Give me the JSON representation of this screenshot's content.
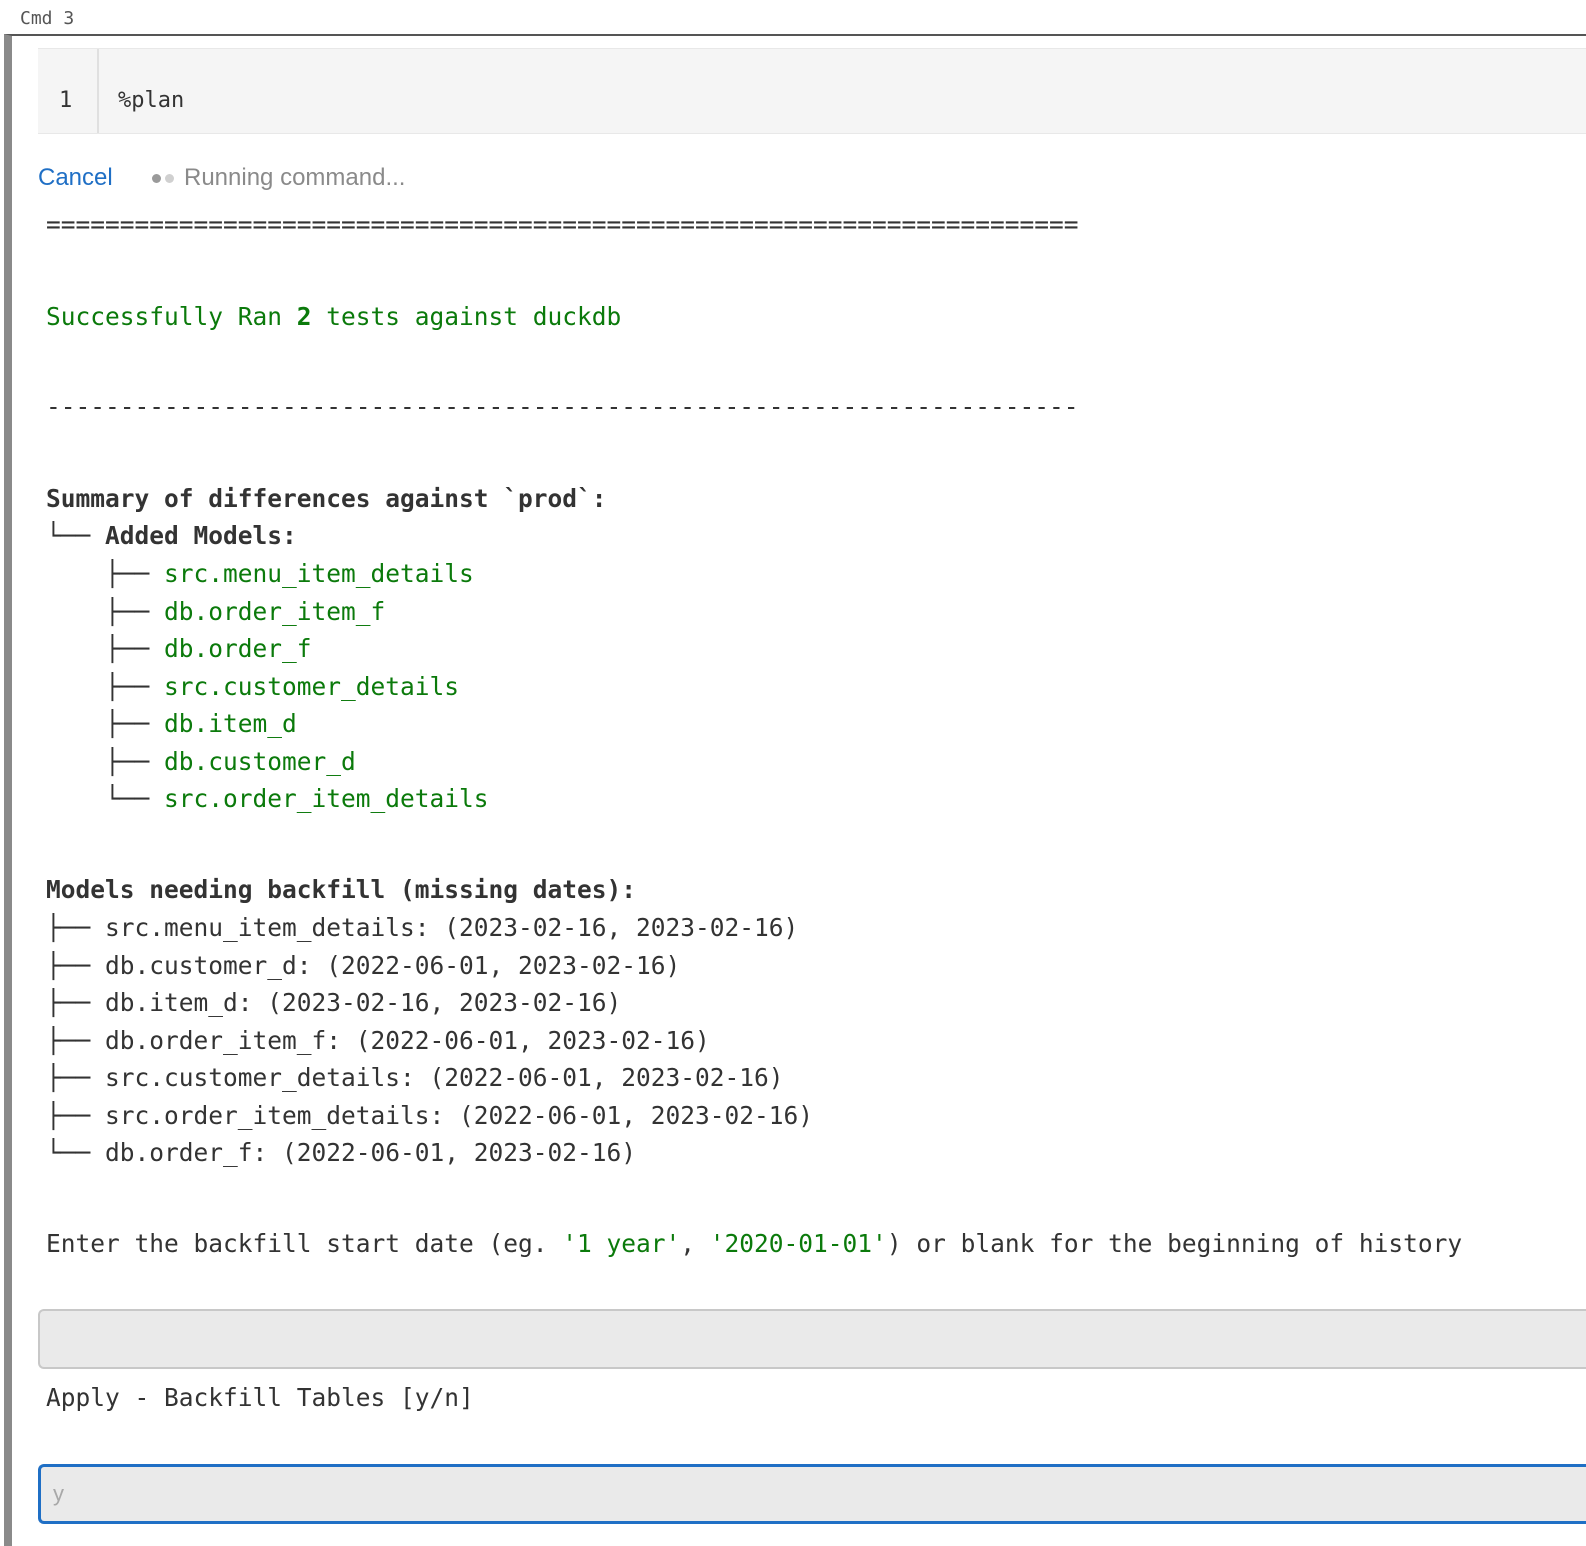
{
  "cell": {
    "label": "Cmd 3"
  },
  "editor": {
    "line_number": "1",
    "code": "%plan"
  },
  "status": {
    "cancel_label": "Cancel",
    "running_text": "Running command..."
  },
  "output": {
    "separator_double": "======================================================================",
    "success_prefix": "Successfully Ran ",
    "success_count": "2",
    "success_suffix": " tests against duckdb",
    "separator_single": "----------------------------------------------------------------------",
    "summary_heading": "Summary of differences against `prod`:",
    "added_models_heading": "└── Added Models:",
    "added_models": [
      {
        "branch": "    ├── ",
        "name": "src.menu_item_details"
      },
      {
        "branch": "    ├── ",
        "name": "db.order_item_f"
      },
      {
        "branch": "    ├── ",
        "name": "db.order_f"
      },
      {
        "branch": "    ├── ",
        "name": "src.customer_details"
      },
      {
        "branch": "    ├── ",
        "name": "db.item_d"
      },
      {
        "branch": "    ├── ",
        "name": "db.customer_d"
      },
      {
        "branch": "    └── ",
        "name": "src.order_item_details"
      }
    ],
    "backfill_heading": "Models needing backfill (missing dates):",
    "backfill_models": [
      "├── src.menu_item_details: (2023-02-16, 2023-02-16)",
      "├── db.customer_d: (2022-06-01, 2023-02-16)",
      "├── db.item_d: (2023-02-16, 2023-02-16)",
      "├── db.order_item_f: (2022-06-01, 2023-02-16)",
      "├── src.customer_details: (2022-06-01, 2023-02-16)",
      "├── src.order_item_details: (2022-06-01, 2023-02-16)",
      "└── db.order_f: (2022-06-01, 2023-02-16)"
    ],
    "prompt_prefix": "Enter the backfill start date (eg. ",
    "prompt_example1": "'1 year'",
    "prompt_comma": ", ",
    "prompt_example2": "'2020-01-01'",
    "prompt_suffix": ") or blank for the beginning of history",
    "apply_prompt": "Apply - Backfill Tables [y/n]"
  },
  "inputs": {
    "start_date_value": "",
    "apply_placeholder": "y"
  },
  "colors": {
    "accent": "#1f6fc5",
    "success_green": "#0b7a0b"
  }
}
